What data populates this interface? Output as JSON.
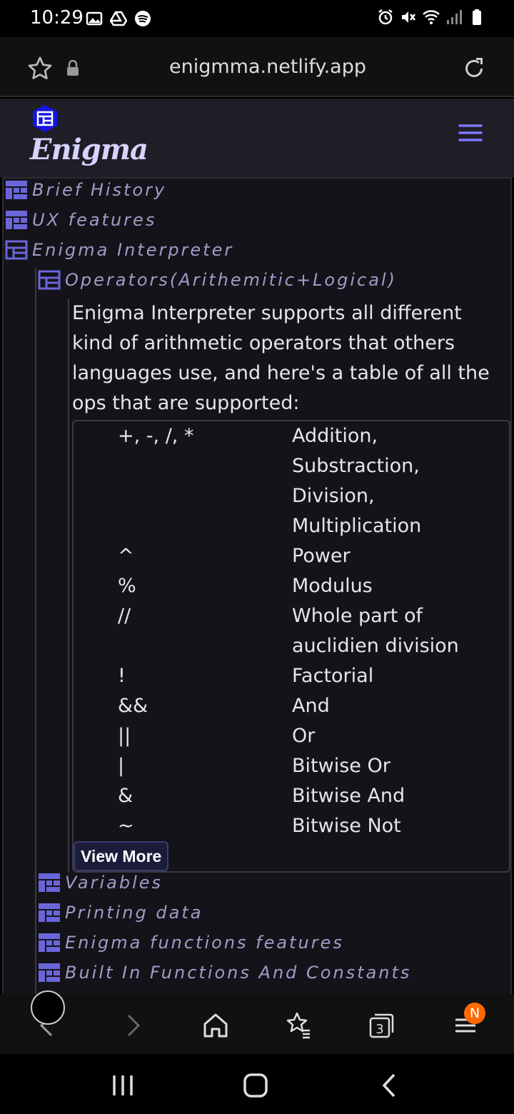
{
  "status_bar": {
    "time": "10:29",
    "left_icons": [
      "image-icon",
      "drive-icon",
      "spotify-icon"
    ],
    "right_icons": [
      "alarm-icon",
      "mute-icon",
      "wifi-icon",
      "signal-icon",
      "battery-icon"
    ]
  },
  "browser": {
    "url": "enigmma.netlify.app"
  },
  "site": {
    "logo_text": "Enigma",
    "accent": "#6c63ff"
  },
  "tree": {
    "items": [
      {
        "label": "Brief History",
        "icon": "collapsed-node-icon"
      },
      {
        "label": "UX features",
        "icon": "collapsed-node-icon"
      },
      {
        "label": "Enigma Interpreter",
        "icon": "expanded-node-icon"
      }
    ],
    "sub_open": {
      "label": "Operators(Arithemitic+Logical)",
      "icon": "expanded-node-icon"
    },
    "sub_items": [
      {
        "label": "Variables"
      },
      {
        "label": "Printing data"
      },
      {
        "label": "Enigma functions features"
      },
      {
        "label": "Built In Functions And Constants"
      }
    ]
  },
  "operators": {
    "description": "Enigma Interpreter supports all different kind of arithmetic operators that others languages use, and here's a table of all the ops that are supported:",
    "rows": [
      {
        "op": "+, -, /, *",
        "desc": "Addition, Substraction, Division, Multiplication"
      },
      {
        "op": "^",
        "desc": "Power"
      },
      {
        "op": "%",
        "desc": "Modulus"
      },
      {
        "op": "//",
        "desc": "Whole part of auclidien division"
      },
      {
        "op": "!",
        "desc": "Factorial"
      },
      {
        "op": "&&",
        "desc": "And"
      },
      {
        "op": "||",
        "desc": "Or"
      },
      {
        "op": "|",
        "desc": "Bitwise Or"
      },
      {
        "op": "&",
        "desc": "Bitwise And"
      },
      {
        "op": "~",
        "desc": "Bitwise Not"
      }
    ],
    "view_more": "View More"
  },
  "toolbar": {
    "tabs_count": "3",
    "menu_badge": "N"
  }
}
